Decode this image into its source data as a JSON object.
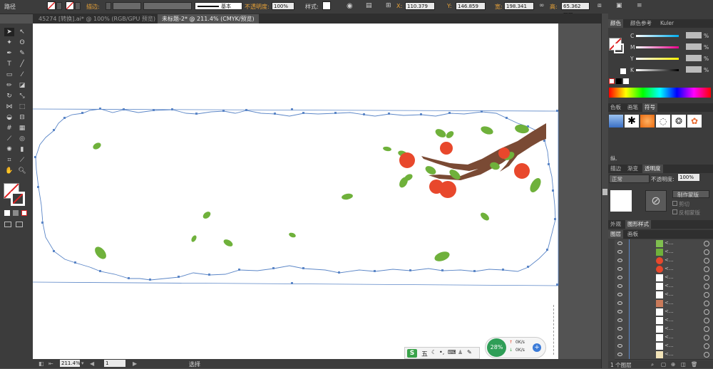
{
  "control_bar": {
    "object_type": "路径",
    "stroke_label": "描边:",
    "brush_label": "基本",
    "opacity_label": "不透明度:",
    "opacity_value": "100%",
    "style_label": "样式:",
    "x_label": "X:",
    "x_value": "110.379",
    "y_label": "Y:",
    "y_value": "146.859",
    "w_label": "宽:",
    "w_value": "198.341",
    "h_label": "高:",
    "h_value": "65.362 mm"
  },
  "tabs": [
    {
      "label": "45274 [转换].ai* @ 100% (RGB/GPU 预览)"
    },
    {
      "label": "未标题-2* @ 211.4% (CMYK/预览)"
    }
  ],
  "status_bar": {
    "zoom": "211.4%",
    "page": "1",
    "tool_status": "选择"
  },
  "color_panel": {
    "tabs": [
      "颜色",
      "颜色参考",
      "Kuler"
    ],
    "channels": [
      {
        "label": "C",
        "unit": "%"
      },
      {
        "label": "M",
        "unit": "%"
      },
      {
        "label": "Y",
        "unit": "%"
      },
      {
        "label": "K",
        "unit": "%"
      }
    ]
  },
  "swatch_panel": {
    "tabs": [
      "色板",
      "画笔",
      "符号"
    ],
    "footer": "纵."
  },
  "transparency_panel": {
    "tabs": [
      "描边",
      "渐变",
      "透明度"
    ],
    "blend_mode": "正常",
    "opacity_label": "不透明度:",
    "opacity_value": "100%",
    "make_mask": "制作蒙版",
    "clip": "剪切",
    "invert_mask": "反相蒙版"
  },
  "appearance_panel": {
    "tabs": [
      "外观",
      "图形样式"
    ]
  },
  "layers_panel": {
    "tabs": [
      "图层",
      "画板"
    ],
    "rows": [
      {
        "name": "<..."
      },
      {
        "name": "<..."
      },
      {
        "name": "<..."
      },
      {
        "name": "<..."
      },
      {
        "name": "<..."
      },
      {
        "name": "<..."
      },
      {
        "name": "<..."
      },
      {
        "name": "<..."
      },
      {
        "name": "<..."
      },
      {
        "name": "<..."
      },
      {
        "name": "<..."
      },
      {
        "name": "<..."
      },
      {
        "name": "<..."
      },
      {
        "name": "<..."
      }
    ],
    "footer": "1 个图层"
  },
  "ime_bar": {
    "mode": "五"
  },
  "net_widget": {
    "percent": "28%",
    "up": "0K/s",
    "down": "0K/s"
  },
  "colors": {
    "accent_blue": "#5b86c7",
    "leaf_green": "#6fb13b",
    "fruit_red": "#e8482c",
    "branch_brown": "#7a4a34"
  }
}
